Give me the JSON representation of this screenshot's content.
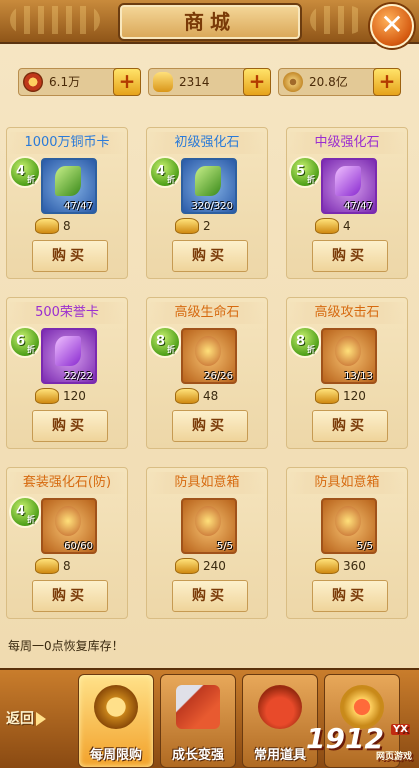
{
  "header": {
    "title": "商城",
    "close_symbol": "✕"
  },
  "currencies": [
    {
      "icon": "honor-icon",
      "value": "6.1万"
    },
    {
      "icon": "gold-ingot-icon",
      "value": "2314"
    },
    {
      "icon": "copper-coin-icon",
      "value": "20.8亿"
    }
  ],
  "plus_symbol": "+",
  "items": [
    {
      "name": "1000万铜币卡",
      "color": "blue",
      "discount": "4",
      "discount_unit": "折",
      "stock": "47/47",
      "price": "8",
      "buy": "购买",
      "icon": "coin-chest-icon"
    },
    {
      "name": "初级强化石",
      "color": "blue",
      "discount": "4",
      "discount_unit": "折",
      "stock": "320/320",
      "price": "2",
      "buy": "购买",
      "icon": "green-crystal-icon"
    },
    {
      "name": "中级强化石",
      "color": "purple",
      "discount": "5",
      "discount_unit": "折",
      "stock": "47/47",
      "price": "4",
      "buy": "购买",
      "icon": "purple-crystal-icon"
    },
    {
      "name": "500荣誉卡",
      "color": "purple",
      "discount": "6",
      "discount_unit": "折",
      "stock": "22/22",
      "price": "120",
      "buy": "购买",
      "icon": "honor-card-icon"
    },
    {
      "name": "高级生命石",
      "color": "orange",
      "discount": "8",
      "discount_unit": "折",
      "stock": "26/26",
      "price": "48",
      "buy": "购买",
      "icon": "green-life-orb-icon"
    },
    {
      "name": "高级攻击石",
      "color": "orange",
      "discount": "8",
      "discount_unit": "折",
      "stock": "13/13",
      "price": "120",
      "buy": "购买",
      "icon": "blue-attack-orb-icon"
    },
    {
      "name": "套装强化石(防)",
      "color": "orange",
      "discount": "4",
      "discount_unit": "折",
      "stock": "60/60",
      "price": "8",
      "buy": "购买",
      "icon": "set-gem-icon"
    },
    {
      "name": "防具如意箱",
      "color": "orange",
      "discount": "",
      "discount_unit": "",
      "stock": "5/5",
      "price": "240",
      "buy": "购买",
      "icon": "armor-chest-icon"
    },
    {
      "name": "防具如意箱",
      "color": "orange",
      "discount": "",
      "discount_unit": "",
      "stock": "5/5",
      "price": "360",
      "buy": "购买",
      "icon": "armor-chest-icon"
    }
  ],
  "notice": "每周一0点恢复库存！",
  "bottom_nav": {
    "back_label": "返回",
    "tabs": [
      {
        "label": "每周限购",
        "icon": "coins-icon",
        "active": true
      },
      {
        "label": "成长变强",
        "icon": "sword-gift-icon",
        "active": false
      },
      {
        "label": "常用道具",
        "icon": "gourd-icon",
        "active": false
      },
      {
        "label": "",
        "icon": "emblem-icon",
        "active": false
      }
    ]
  },
  "watermark": {
    "main": "1912",
    "badge": "YX",
    "sub": "网页游戏"
  },
  "colors": {
    "blue_name": "#2a7ad8",
    "purple_name": "#9b2ed0",
    "orange_name": "#d66a10",
    "discount_badge": "#4ea018"
  }
}
